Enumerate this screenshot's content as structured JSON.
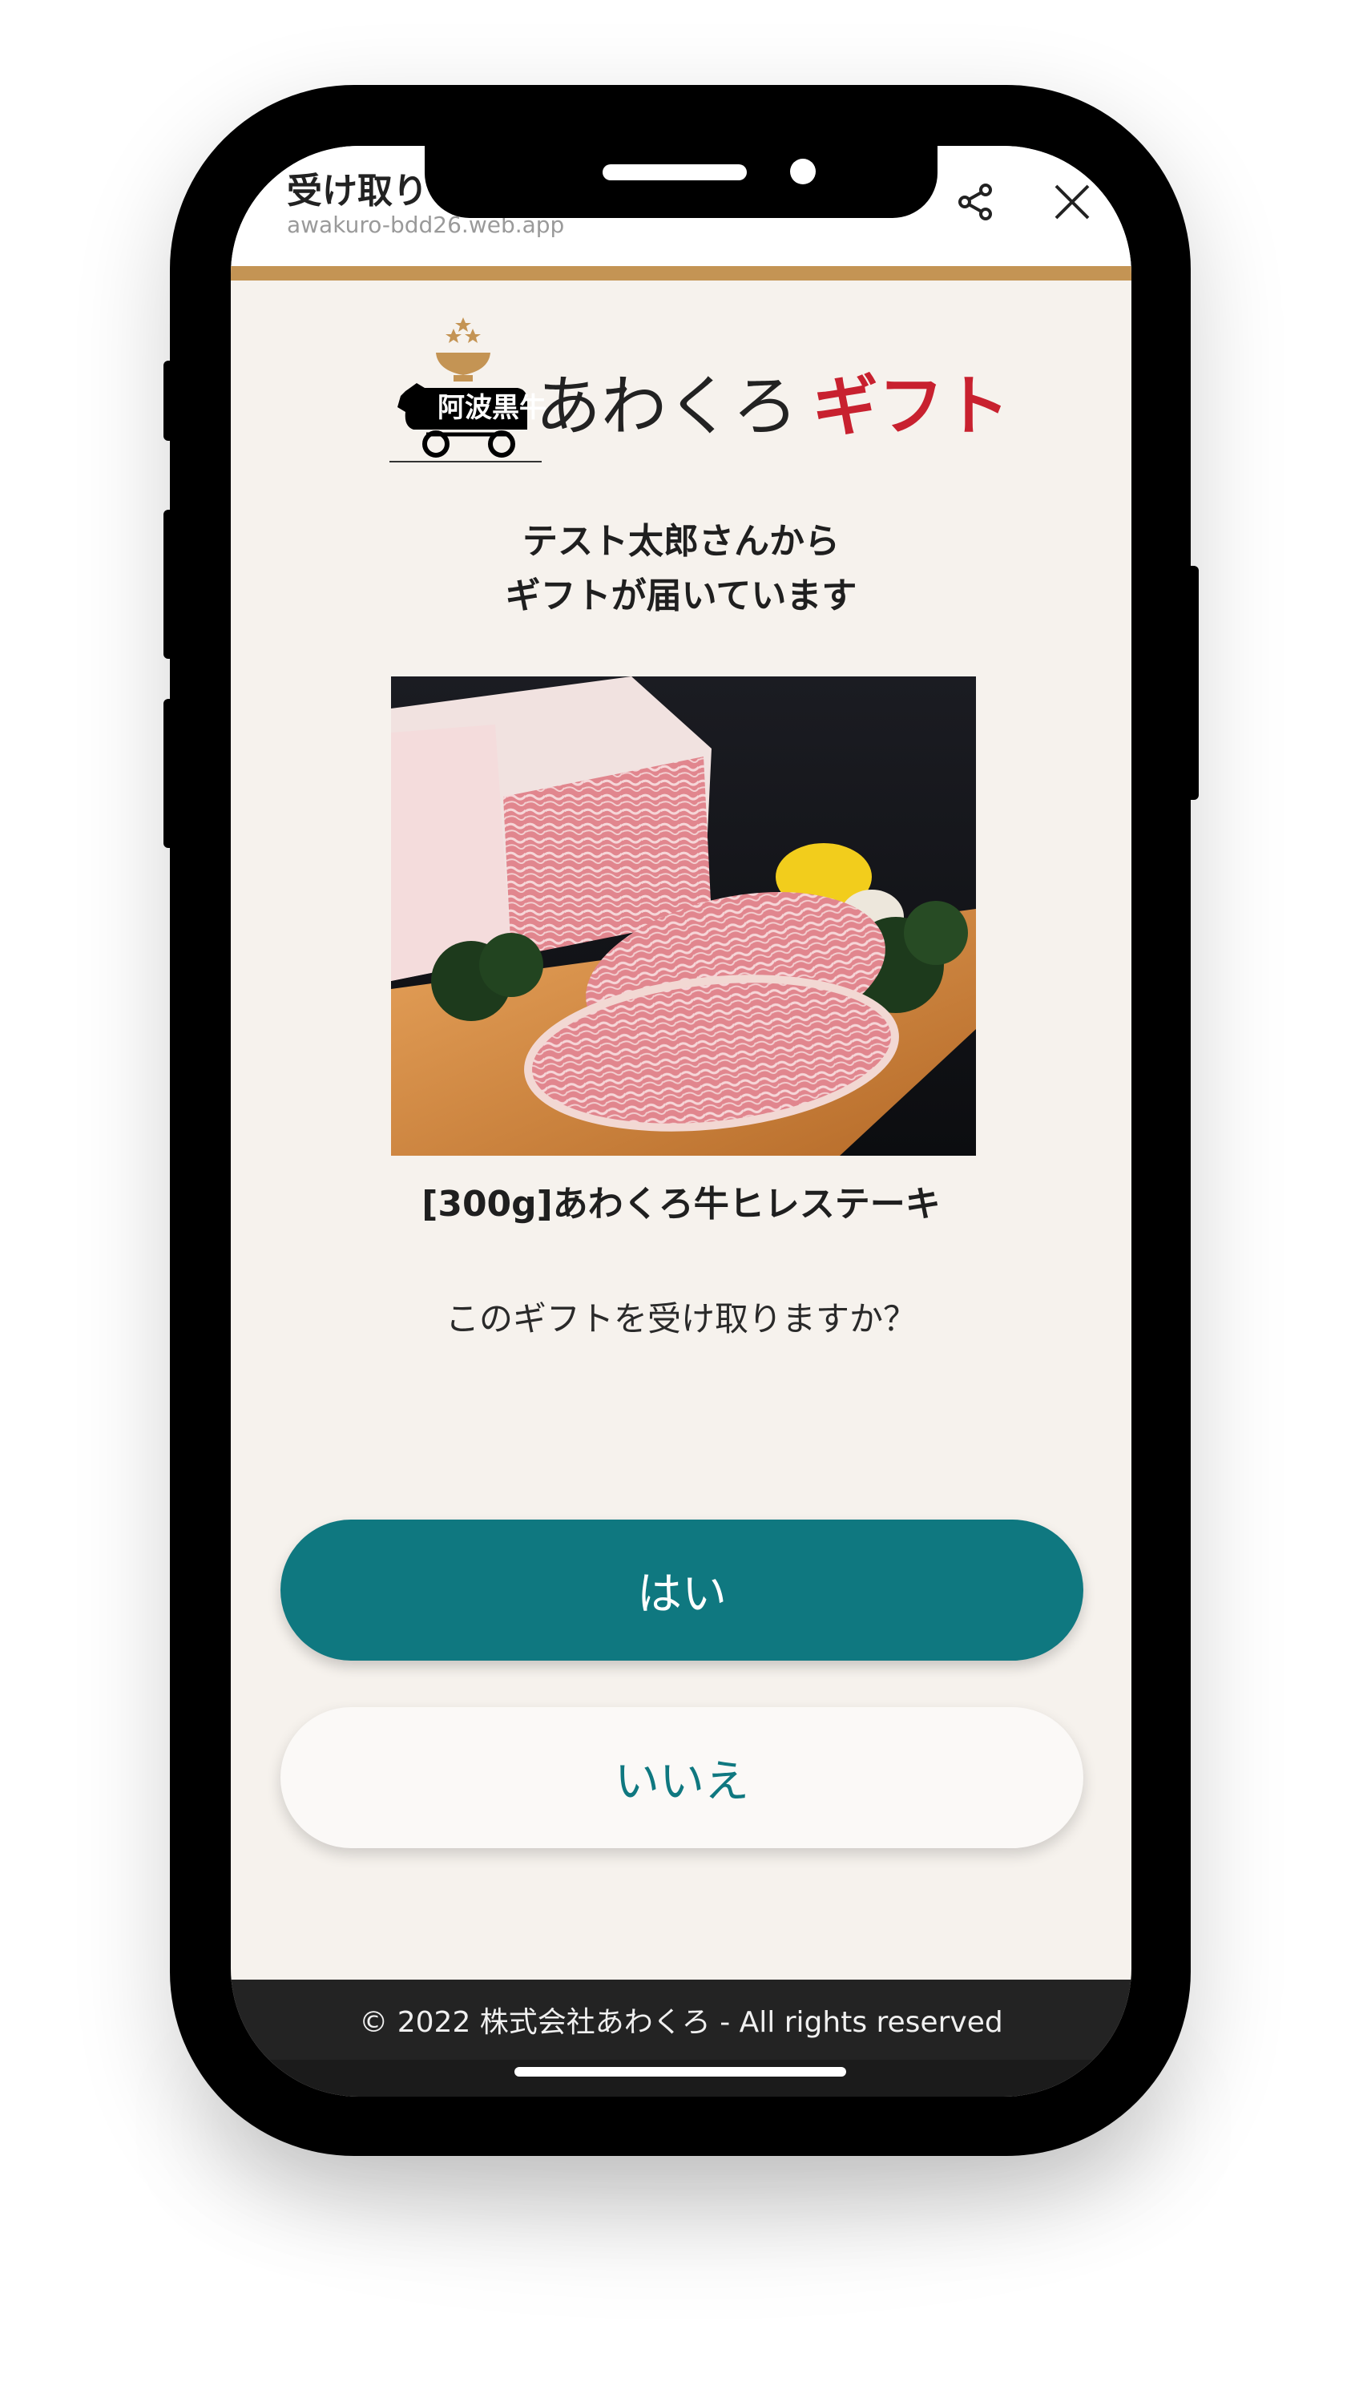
{
  "browser": {
    "title": "受け取り",
    "url": "awakuro-bdd26.web.app",
    "share_icon": "share-icon",
    "close_icon": "close-icon"
  },
  "logo": {
    "emblem_text": "阿波黒牛",
    "brand": "あわくろ",
    "gift": "ギフト"
  },
  "gift_message": {
    "line1": "テスト太郎さんから",
    "line2": "ギフトが届いています"
  },
  "product": {
    "name": "[300g]あわくろ牛ヒレステーキ"
  },
  "question": "このギフトを受け取りますか？",
  "buttons": {
    "yes": "はい",
    "no": "いいえ"
  },
  "footer": {
    "copyright": "© 2022 株式会社あわくろ - All rights reserved"
  },
  "colors": {
    "accent_teal": "#0f7880",
    "gift_red": "#c8212f",
    "header_bar": "#c49454",
    "background": "#f6f2ed"
  }
}
